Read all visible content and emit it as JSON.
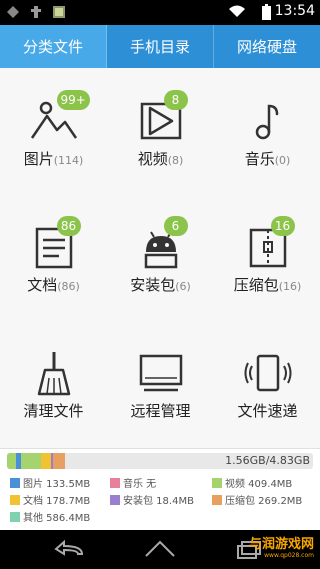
{
  "status": {
    "time": "13:54"
  },
  "tabs": [
    {
      "label": "分类文件"
    },
    {
      "label": "手机目录"
    },
    {
      "label": "网络硬盘"
    }
  ],
  "categories": [
    {
      "label": "图片",
      "count": "(114)",
      "badge": "99+"
    },
    {
      "label": "视频",
      "count": "(8)",
      "badge": "8"
    },
    {
      "label": "音乐",
      "count": "(0)",
      "badge": ""
    },
    {
      "label": "文档",
      "count": "(86)",
      "badge": "86"
    },
    {
      "label": "安装包",
      "count": "(6)",
      "badge": "6"
    },
    {
      "label": "压缩包",
      "count": "(16)",
      "badge": "16"
    },
    {
      "label": "清理文件",
      "count": "",
      "badge": ""
    },
    {
      "label": "远程管理",
      "count": "",
      "badge": ""
    },
    {
      "label": "文件速递",
      "count": "",
      "badge": ""
    }
  ],
  "storage": {
    "summary": "1.56GB/4.83GB",
    "legend": [
      {
        "label": "图片 133.5MB",
        "color": "#4a90d9"
      },
      {
        "label": "音乐 无",
        "color": "#e8809a"
      },
      {
        "label": "视频 409.4MB",
        "color": "#a5d36e"
      },
      {
        "label": "文档 178.7MB",
        "color": "#f1c232"
      },
      {
        "label": "安装包 18.4MB",
        "color": "#9a7fd1"
      },
      {
        "label": "压缩包 269.2MB",
        "color": "#e8a060"
      },
      {
        "label": "其他 586.4MB",
        "color": "#7fd1b0"
      }
    ]
  },
  "watermark": {
    "text": "与润游戏网",
    "sub": "www.qp028.com"
  },
  "colors": {
    "accent": "#2d8fd6",
    "badge": "#8cc34a"
  }
}
